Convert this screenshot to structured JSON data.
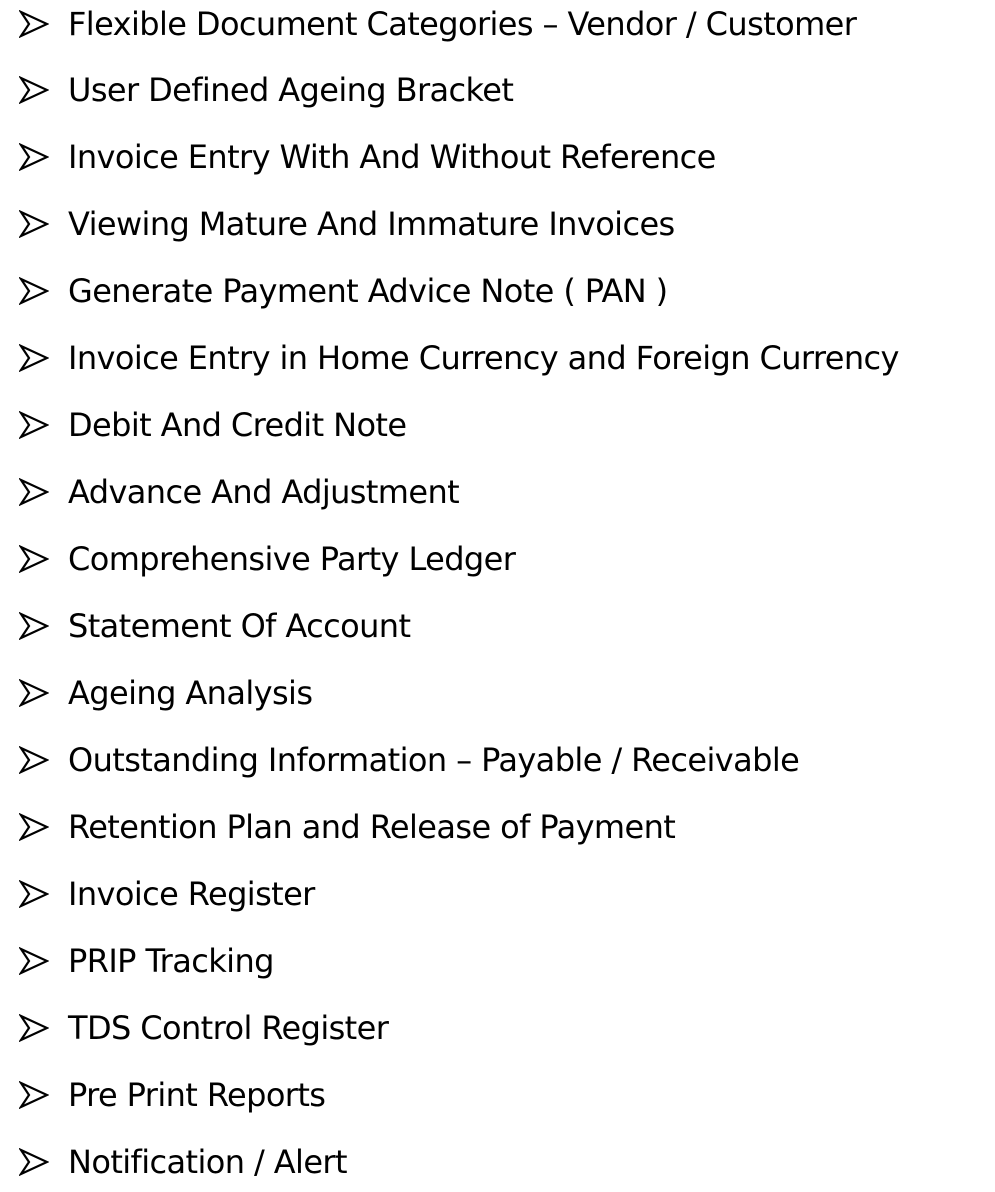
{
  "bullet_icon": "arrowhead-bullet-icon",
  "text_color": "#000000",
  "features": [
    "Flexible Document Categories – Vendor / Customer",
    "User Defined Ageing Bracket",
    "Invoice Entry With And Without Reference",
    "Viewing Mature And Immature Invoices",
    "Generate Payment Advice Note ( PAN )",
    "Invoice Entry in Home Currency and Foreign Currency",
    "Debit And Credit Note",
    "Advance And Adjustment",
    "Comprehensive Party Ledger",
    "Statement Of Account",
    "Ageing Analysis",
    "Outstanding Information – Payable / Receivable",
    "Retention Plan and Release of Payment",
    "Invoice Register",
    "PRIP Tracking",
    "TDS Control Register",
    "Pre Print Reports",
    "Notification / Alert"
  ]
}
